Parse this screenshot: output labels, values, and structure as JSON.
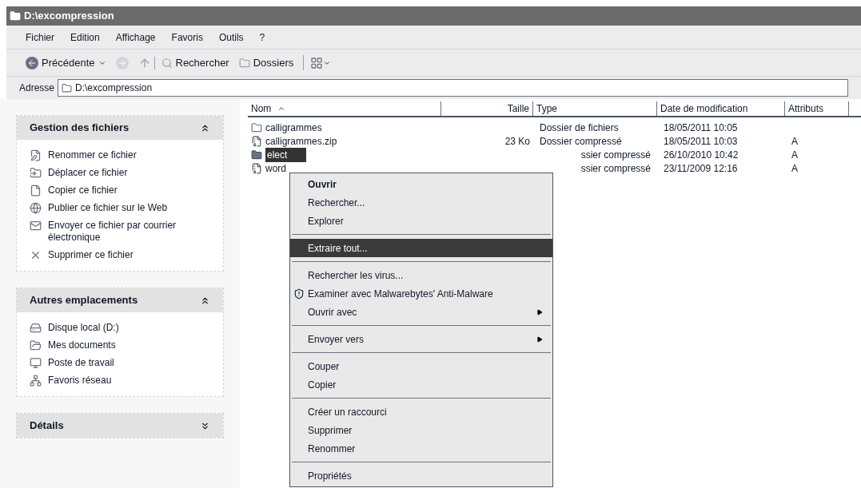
{
  "window": {
    "title": "D:\\excompression"
  },
  "menu_bar": [
    "Fichier",
    "Edition",
    "Affichage",
    "Favoris",
    "Outils",
    "?"
  ],
  "toolbar": [
    {
      "kind": "back",
      "label": "Précédente"
    },
    {
      "kind": "forward"
    },
    {
      "kind": "up"
    },
    {
      "kind": "search",
      "label": "Rechercher"
    },
    {
      "kind": "folders",
      "label": "Dossiers"
    },
    {
      "kind": "views"
    }
  ],
  "address_bar": {
    "label": "Adresse",
    "value": "D:\\excompression"
  },
  "sidebar": [
    {
      "title": "Gestion des fichiers",
      "expanded": true,
      "items": [
        "Renommer ce fichier",
        "Déplacer ce fichier",
        "Copier ce fichier",
        "Publier ce fichier sur le Web",
        "Envoyer ce fichier par courrier électronique",
        "Supprimer ce fichier"
      ]
    },
    {
      "title": "Autres emplacements",
      "expanded": true,
      "items": [
        "Disque local (D:)",
        "Mes documents",
        "Poste de travail",
        "Favoris réseau"
      ]
    },
    {
      "title": "Détails",
      "expanded": false
    }
  ],
  "table": {
    "columns": [
      {
        "label": "Nom",
        "sorted": true
      },
      {
        "label": "Taille",
        "sorted": false
      },
      {
        "label": "Type",
        "sorted": false
      },
      {
        "label": "Date de modification",
        "sorted": false
      },
      {
        "label": "Attributs",
        "sorted": false
      }
    ],
    "rows": [
      {
        "kind": "folder",
        "selected": false,
        "name": "calligrammes",
        "type": "Dossier de fichiers",
        "date": "18/05/2011 10:05"
      },
      {
        "kind": "zip",
        "selected": false,
        "name": "calligrammes.zip",
        "size": "23 Ko",
        "type": "Dossier compressé",
        "date": "18/05/2011 10:03",
        "attributes": "A"
      },
      {
        "kind": "zip-folder",
        "selected": true,
        "name": "elect",
        "type": "ssier compressé",
        "date": "26/10/2010 10:42",
        "attributes": "A"
      },
      {
        "kind": "zip",
        "selected": false,
        "name": "word",
        "type": "ssier compressé",
        "date": "23/11/2009 12:16",
        "attributes": "A"
      }
    ]
  },
  "context_menu": [
    {
      "kind": "default",
      "label": "Ouvrir",
      "selected": false
    },
    {
      "kind": "item",
      "label": "Rechercher...",
      "selected": false
    },
    {
      "kind": "item",
      "label": "Explorer",
      "selected": false
    },
    {
      "kind": "separator"
    },
    {
      "kind": "item",
      "label": "Extraire tout...",
      "selected": true
    },
    {
      "kind": "separator"
    },
    {
      "kind": "item",
      "label": "Rechercher les virus...",
      "selected": false
    },
    {
      "kind": "icon",
      "label": "Examiner avec Malwarebytes' Anti-Malware",
      "selected": false
    },
    {
      "kind": "submenu",
      "label": "Ouvrir avec",
      "selected": false
    },
    {
      "kind": "separator"
    },
    {
      "kind": "submenu",
      "label": "Envoyer vers",
      "selected": false
    },
    {
      "kind": "separator"
    },
    {
      "kind": "item",
      "label": "Couper",
      "selected": false
    },
    {
      "kind": "item",
      "label": "Copier",
      "selected": false
    },
    {
      "kind": "separator"
    },
    {
      "kind": "item",
      "label": "Créer un raccourci",
      "selected": false
    },
    {
      "kind": "item",
      "label": "Supprimer",
      "selected": false
    },
    {
      "kind": "item",
      "label": "Renommer",
      "selected": false
    },
    {
      "kind": "separator"
    },
    {
      "kind": "item",
      "label": "Propriétés",
      "selected": false
    }
  ]
}
